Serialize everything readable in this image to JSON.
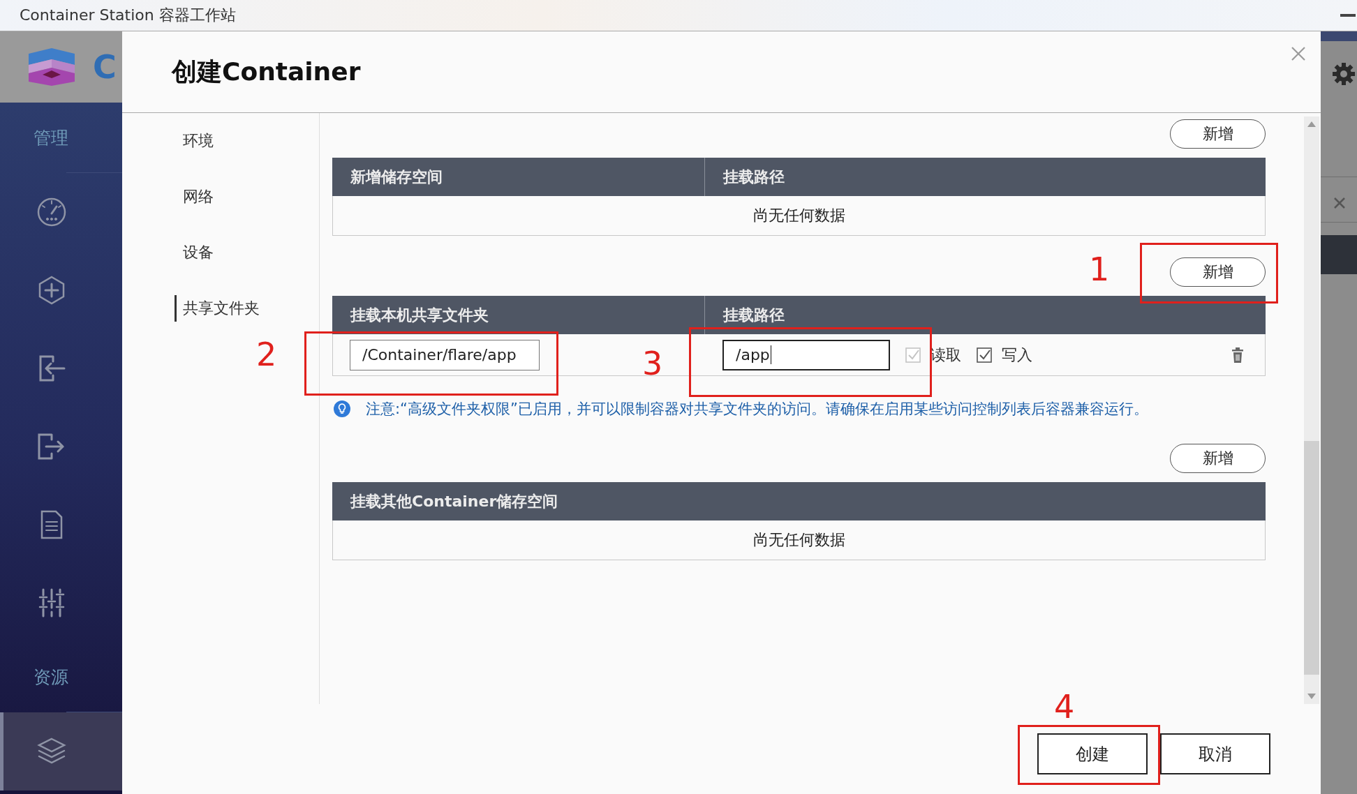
{
  "app": {
    "title": "Container Station 容器工作站",
    "logo_text": "C",
    "sidebar": [
      {
        "label": "管理",
        "items": [
          {
            "kind": "dashboard",
            "selected": false
          },
          {
            "kind": "create",
            "selected": false
          },
          {
            "kind": "import",
            "selected": false
          },
          {
            "kind": "export",
            "selected": false
          },
          {
            "kind": "log",
            "selected": false
          },
          {
            "kind": "properties",
            "selected": false
          }
        ]
      },
      {
        "label": "资源",
        "items": [
          {
            "kind": "images",
            "selected": true
          }
        ]
      }
    ]
  },
  "dialog": {
    "title": "创建Container",
    "nav": [
      {
        "label": "环境",
        "selected": false
      },
      {
        "label": "网络",
        "selected": false
      },
      {
        "label": "设备",
        "selected": false
      },
      {
        "label": "共享文件夹",
        "selected": true
      }
    ],
    "sections": [
      {
        "button": "新增",
        "columns": [
          "新增储存空间",
          "挂载路径"
        ],
        "empty_text": "尚无任何数据"
      },
      {
        "button": "新增",
        "columns": [
          "挂载本机共享文件夹",
          "挂载路径"
        ],
        "rows": [
          {
            "host_folder": "/Container/flare/app",
            "mount_path": "/app",
            "mount_path_focused": true,
            "permissions": [
              {
                "label": "读取",
                "checked": true,
                "disabled": true
              },
              {
                "label": "写入",
                "checked": true,
                "disabled": false
              }
            ]
          }
        ],
        "note": "注意:“高级文件夹权限”已启用，并可以限制容器对共享文件夹的访问。请确保在启用某些访问控制列表后容器兼容运行。"
      },
      {
        "button": "新增",
        "columns": [
          "挂载其他Container储存空间"
        ],
        "empty_text": "尚无任何数据"
      }
    ],
    "buttons": [
      {
        "label": "创建"
      },
      {
        "label": "取消"
      }
    ]
  },
  "annotations": [
    {
      "label": "1"
    },
    {
      "label": "2"
    },
    {
      "label": "3"
    },
    {
      "label": "4"
    }
  ]
}
